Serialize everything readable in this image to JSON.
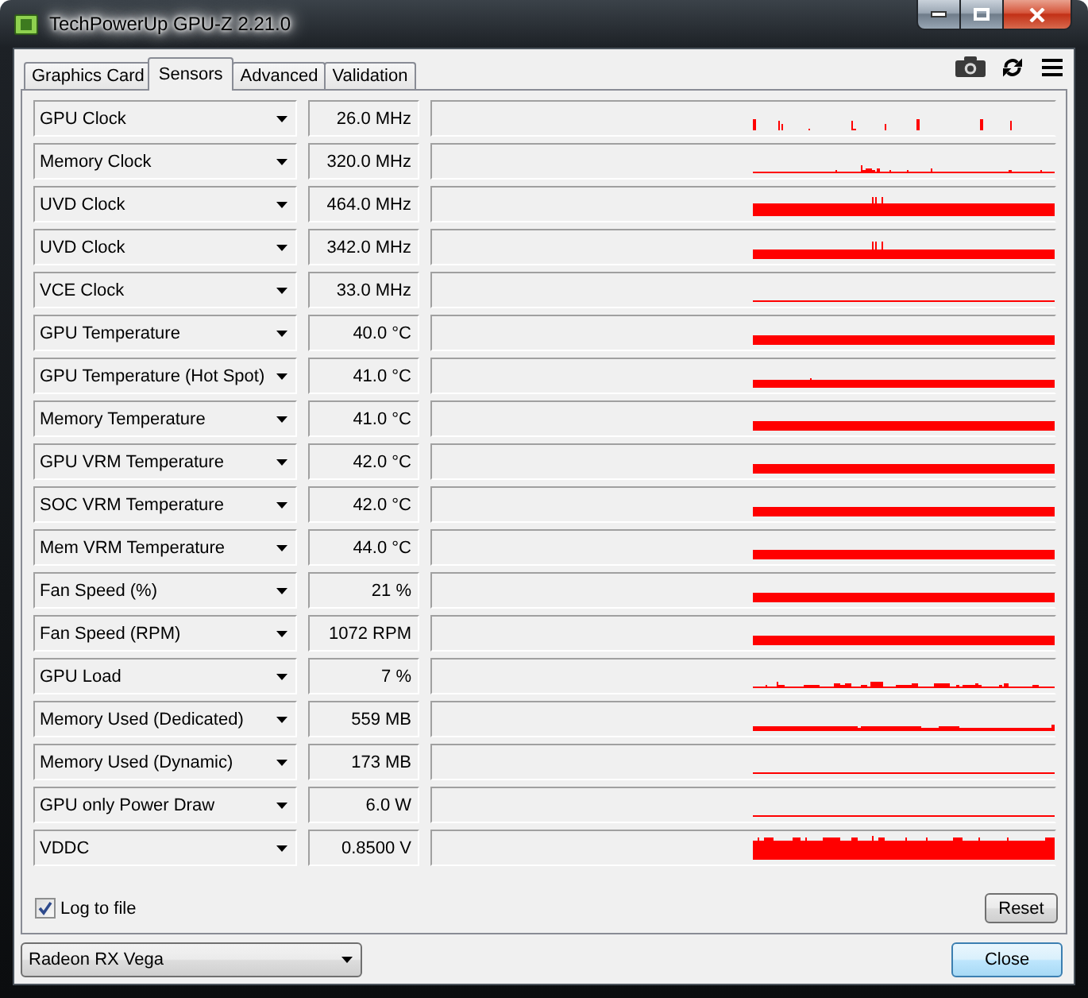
{
  "window": {
    "title": "TechPowerUp GPU-Z 2.21.0"
  },
  "tabs": [
    {
      "label": "Graphics Card",
      "selected": false
    },
    {
      "label": "Sensors",
      "selected": true
    },
    {
      "label": "Advanced",
      "selected": false
    },
    {
      "label": "Validation",
      "selected": false
    }
  ],
  "sensors": [
    {
      "name": "GPU Clock",
      "value": "26.0 MHz"
    },
    {
      "name": "Memory Clock",
      "value": "320.0 MHz"
    },
    {
      "name": "UVD Clock",
      "value": "464.0 MHz"
    },
    {
      "name": "UVD Clock",
      "value": "342.0 MHz"
    },
    {
      "name": "VCE Clock",
      "value": "33.0 MHz"
    },
    {
      "name": "GPU Temperature",
      "value": "40.0 °C"
    },
    {
      "name": "GPU Temperature (Hot Spot)",
      "value": "41.0 °C"
    },
    {
      "name": "Memory Temperature",
      "value": "41.0 °C"
    },
    {
      "name": "GPU VRM Temperature",
      "value": "42.0 °C"
    },
    {
      "name": "SOC VRM Temperature",
      "value": "42.0 °C"
    },
    {
      "name": "Mem VRM Temperature",
      "value": "44.0 °C"
    },
    {
      "name": "Fan Speed (%)",
      "value": "21 %"
    },
    {
      "name": "Fan Speed (RPM)",
      "value": "1072 RPM"
    },
    {
      "name": "GPU Load",
      "value": "7 %"
    },
    {
      "name": "Memory Used (Dedicated)",
      "value": "559 MB"
    },
    {
      "name": "Memory Used (Dynamic)",
      "value": "173 MB"
    },
    {
      "name": "GPU only Power Draw",
      "value": "6.0 W"
    },
    {
      "name": "VDDC",
      "value": "0.8500 V"
    }
  ],
  "log_to_file": {
    "label": "Log to file",
    "checked": true
  },
  "reset_button": {
    "label": "Reset"
  },
  "device_select": {
    "value": "Radeon RX Vega"
  },
  "close_button": {
    "label": "Close",
    "focused": true
  }
}
